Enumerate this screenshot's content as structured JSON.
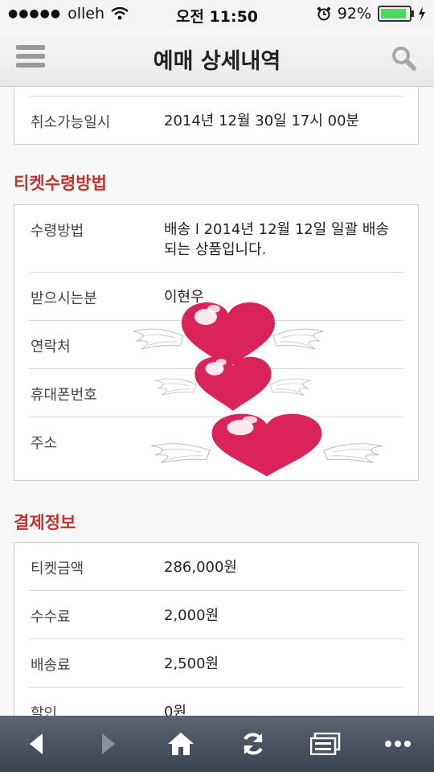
{
  "status_bar": {
    "carrier": "olleh",
    "time": "오전 11:50",
    "battery_percent": "92%",
    "battery_level": 0.92
  },
  "header": {
    "title": "예매 상세내역"
  },
  "cancel_card": {
    "label": "취소가능일시",
    "value": "2014년 12월 30일 17시 00분"
  },
  "ticket_section": {
    "title": "티켓수령방법",
    "rows": [
      {
        "label": "수령방법",
        "value": "배송 l 2014년 12월 12일 일괄 배송되는 상품입니다."
      },
      {
        "label": "받으시는분",
        "value": "이현우"
      },
      {
        "label": "연락처",
        "value": ""
      },
      {
        "label": "휴대폰번호",
        "value": ""
      },
      {
        "label": "주소",
        "value": ""
      }
    ]
  },
  "payment_section": {
    "title": "결제정보",
    "rows": [
      {
        "label": "티켓금액",
        "value": "286,000원"
      },
      {
        "label": "수수료",
        "value": "2,000원"
      },
      {
        "label": "배송료",
        "value": "2,500원"
      },
      {
        "label": "할인",
        "value": "0원"
      }
    ]
  },
  "colors": {
    "accent": "#c0332f",
    "heart": "#d9235a",
    "toolbar": "#4a515d"
  }
}
